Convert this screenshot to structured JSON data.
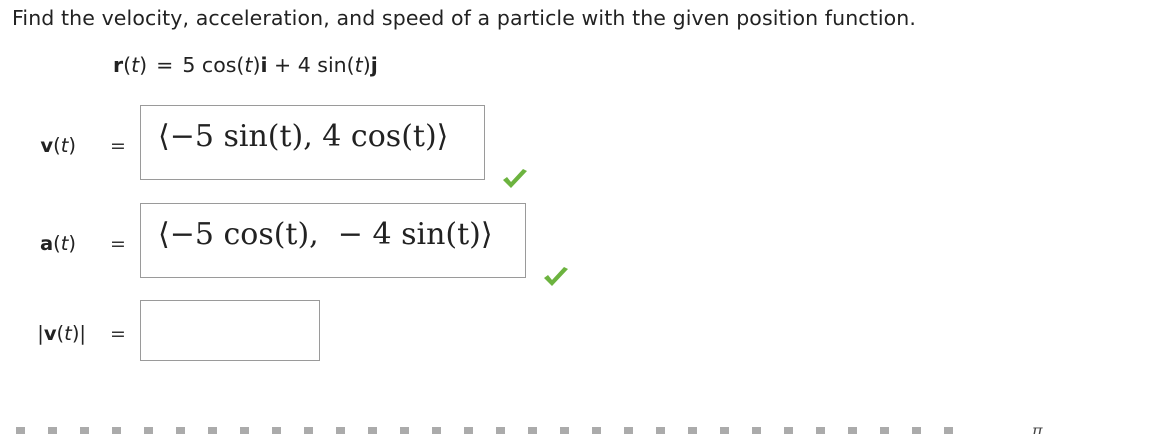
{
  "prompt": "Find the velocity, acceleration, and speed of a particle with the given position function.",
  "position_function": {
    "lhs_vec": "r",
    "lhs_var": "t",
    "equals": "=",
    "term1": "5 cos(",
    "term1_var": "t",
    "term1_close": ")",
    "unit_i": "i",
    "plus": " + ",
    "term2": "4 sin(",
    "term2_var": "t",
    "term2_close": ")",
    "unit_j": "j"
  },
  "rows": [
    {
      "label_prefix": "",
      "label_vec": "v",
      "label_var": "t",
      "label_suffix": "",
      "equals": "=",
      "answer": "⟨−5 sin(t), 4 cos(t)⟩",
      "status": "correct"
    },
    {
      "label_prefix": "",
      "label_vec": "a",
      "label_var": "t",
      "label_suffix": "",
      "equals": "=",
      "answer": "⟨−5 cos(t),  − 4 sin(t)⟩",
      "status": "correct"
    },
    {
      "label_prefix": "|",
      "label_vec": "v",
      "label_var": "t",
      "label_suffix": "|",
      "equals": "=",
      "answer": "",
      "status": "empty"
    }
  ],
  "next_line_partial": "π",
  "colors": {
    "text": "#222222",
    "box_border": "#9a9a9a",
    "check_green": "#6cb33f"
  },
  "icons": {
    "correct": "checkmark-icon"
  }
}
